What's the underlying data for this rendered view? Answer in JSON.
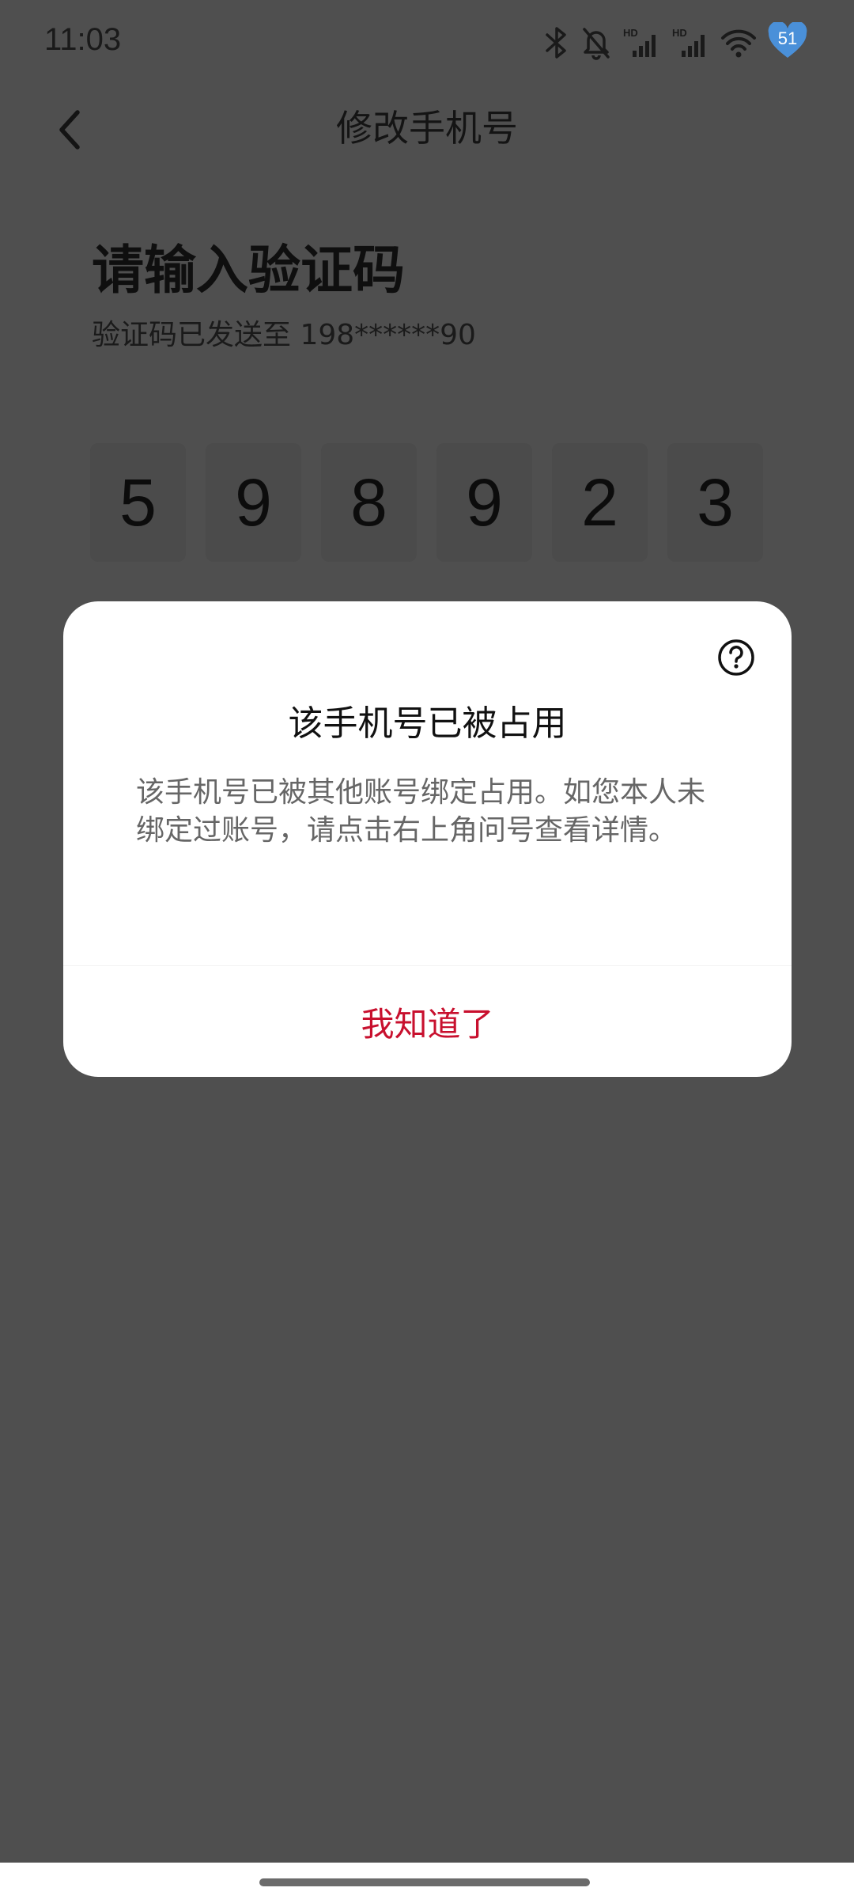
{
  "status_bar": {
    "time": "11:03",
    "hd1": "HD",
    "hd2": "HD",
    "battery": "51",
    "icons": [
      "bluetooth-icon",
      "bell-off-icon",
      "signal-hd-icon",
      "signal-hd-icon",
      "wifi-icon",
      "battery-heart-icon"
    ]
  },
  "nav": {
    "title": "修改手机号",
    "back_icon": "chevron-left-icon"
  },
  "verify": {
    "heading": "请输入验证码",
    "sent_to": "验证码已发送至 198******90",
    "code_digits": [
      "5",
      "9",
      "8",
      "9",
      "2",
      "3"
    ]
  },
  "dialog": {
    "title": "该手机号已被占用",
    "message": "该手机号已被其他账号绑定占用。如您本人未绑定过账号，请点击右上角问号查看详情。",
    "confirm_label": "我知道了",
    "help_icon": "question-circle-icon"
  },
  "colors": {
    "overlay_background": "#4f4f4f",
    "dialog_background": "#ffffff",
    "confirm_text": "#c8102e",
    "message_text": "#666666",
    "battery_badge": "#4a90d9"
  }
}
